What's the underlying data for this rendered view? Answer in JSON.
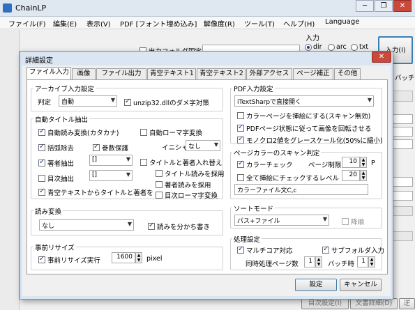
{
  "app": {
    "title": "ChainLP",
    "window_buttons": [
      "─",
      "❐",
      "✕"
    ],
    "menu": [
      "ファイル(F)",
      "編集(E)",
      "表示(V)",
      "PDF [フォント埋め込み]",
      "解像度(R)",
      "ツール(T)",
      "ヘルプ(H)",
      "Language"
    ]
  },
  "background": {
    "input_label": "入力",
    "radio_dir": "dir",
    "radio_arc": "arc",
    "radio_txt": "txt",
    "input_button": "入力(I)",
    "output_label": "出力フォルダ固定",
    "batch_label": "バッチ",
    "bottom_btn1": "目次設定(I)",
    "bottom_btn2": "文書詳細(D)",
    "bottom_btn3": "逆"
  },
  "dialog": {
    "title": "詳細設定",
    "tabs": [
      "ファイル入力",
      "画像",
      "ファイル出力",
      "青空テキスト1",
      "青空テキスト2",
      "外部アクセス",
      "ページ補正",
      "その他"
    ],
    "archive": {
      "group": "アーカイブ入力設定",
      "judge_label": "判定",
      "judge_value": "自動",
      "unzip": "unzip32.dllのダメ字対策"
    },
    "autotitle": {
      "group": "自動タイトル抽出",
      "auto_read": "自動読み変換(カタカナ)",
      "auto_roma": "自動ローマ字変換",
      "bracket_remove": "括弧除去",
      "volume_keep": "巻数保護",
      "initial_label": "イニシャル付",
      "initial_value": "なし",
      "author_extract": "著者抽出",
      "author_value": "[]",
      "swap": "タイトルと著者入れ替え",
      "title_read": "タイトル読みを採用",
      "toc_extract": "目次抽出",
      "toc_value": "[]",
      "author_read": "著者読みを採用",
      "toc_roma": "目次ローマ字変換",
      "aozora": "青空テキストからタイトルと著者を"
    },
    "reading": {
      "group": "読み変換",
      "value": "なし",
      "split": "読みを分かち書き"
    },
    "resize": {
      "group": "事前リサイズ",
      "run": "事前リサイズ実行",
      "value": "1600",
      "unit": "pixel"
    },
    "pdf": {
      "group": "PDF入力設定",
      "mode": "iTextSharpで直接開く",
      "insert_color": "カラーページを挿絵にする(スキャン無効)",
      "rotate": "PDFページ状態に従って画像を回転させる",
      "grayscale": "モノクロ2値をグレースケール化(50%に縮小)"
    },
    "colorscan": {
      "group": "ページカラーのスキャン判定",
      "check": "カラーチェック",
      "limit_label": "ページ制限",
      "limit_value": "10",
      "limit_unit": "P",
      "all_insert": "全て挿絵にチェックするレベル",
      "level_value": "20",
      "filename": "カラーファイル文C,c"
    },
    "sort": {
      "group": "ソートモード",
      "value": "パス+ファイル",
      "desc": "降順"
    },
    "process": {
      "group": "処理設定",
      "multicore": "マルチコア対応",
      "subfolder": "サブフォルダ入力",
      "pages_label": "同時処理ページ数",
      "pages_value": "1",
      "batch_label": "バッチ時",
      "batch_value": "1"
    },
    "ok": "設定",
    "cancel": "キャンセル"
  }
}
